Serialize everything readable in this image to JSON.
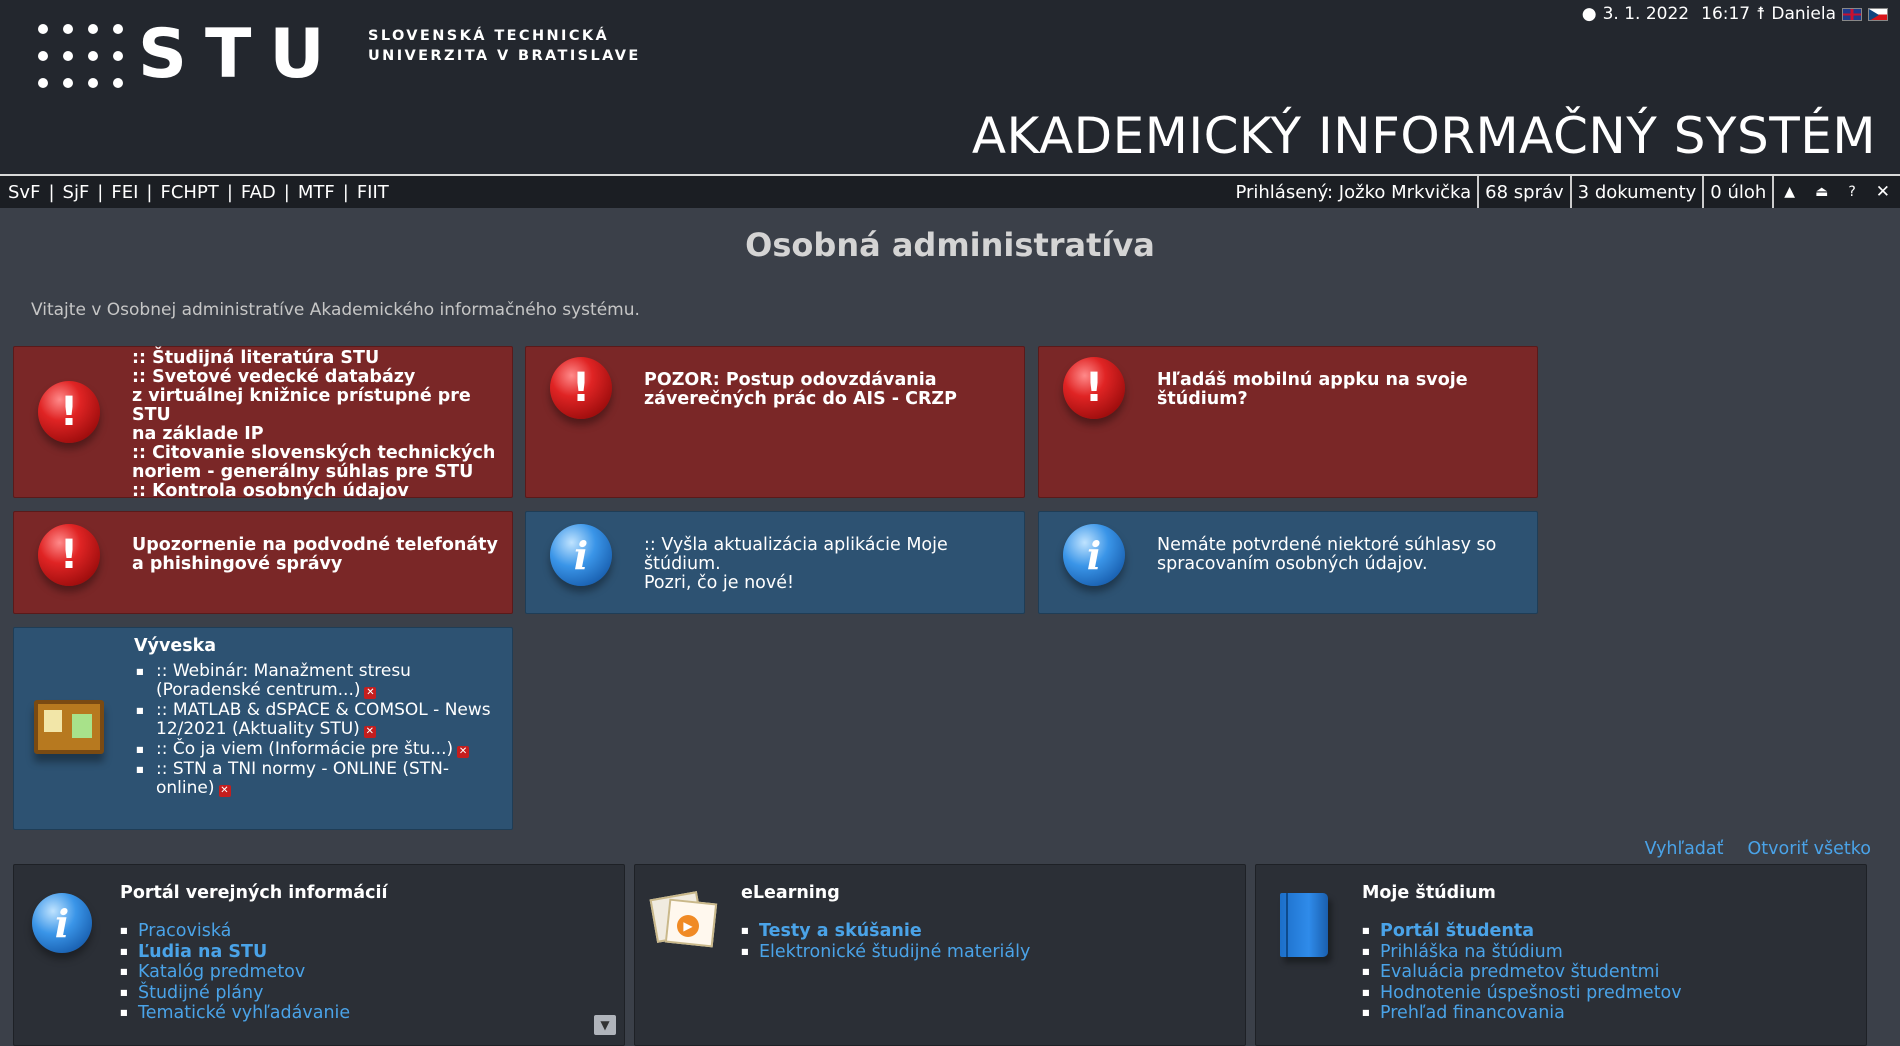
{
  "header": {
    "logo_text": "STU",
    "university_line1": "SLOVENSKÁ TECHNICKÁ",
    "university_line2": "UNIVERZITA V BRATISLAVE",
    "date": "3. 1. 2022",
    "time": "16:17",
    "nameday": "Daniela",
    "system_title": "AKADEMICKÝ INFORMAČNÝ SYSTÉM"
  },
  "nav": {
    "faculties": [
      "SvF",
      "SjF",
      "FEI",
      "FCHPT",
      "FAD",
      "MTF",
      "FIIT"
    ],
    "logged_in": "Prihlásený: Jožko Mrkvička",
    "messages": "68 správ",
    "documents": "3 dokumenty",
    "tasks": "0 úloh",
    "icons": [
      "arrow-up-icon",
      "home-up-icon",
      "help-icon",
      "close-icon"
    ]
  },
  "main": {
    "title": "Osobná administratíva",
    "welcome": "Vitajte v Osobnej administratíve Akademického informačného systému."
  },
  "notices": {
    "box1": {
      "lines": [
        "::  Študijná literatúra STU",
        "::  Svetové vedecké databázy",
        "z virtuálnej knižnice prístupné pre STU",
        "na základe IP",
        "::  Citovanie slovenských technických",
        "noriem - generálny súhlas pre STU",
        "::  Kontrola osobných údajov"
      ]
    },
    "box2": {
      "lines": [
        "POZOR: Postup odovzdávania",
        "záverečných prác do AIS - CRZP"
      ]
    },
    "box3": {
      "lines": [
        "Hľadáš mobilnú appku na svoje",
        "štúdium?"
      ]
    },
    "box4": {
      "lines": [
        "Upozornenie na podvodné telefonáty",
        "a phishingové správy"
      ]
    },
    "box5": {
      "lines": [
        ":: Vyšla aktualizácia aplikácie Moje štúdium.",
        "Pozri, čo je nové!"
      ]
    },
    "box6": {
      "lines": [
        "Nemáte potvrdené niektoré súhlasy so",
        "spracovaním osobných údajov."
      ]
    }
  },
  "vyveska": {
    "title": "Vývesk​a",
    "items": [
      "::  Webinár: Manažment stresu (Poradenské centrum...)",
      "::  MATLAB & dSPACE & COMSOL - News 12/2021 (Aktuality STU)",
      "::  Čo ja viem (Informácie pre štu...)",
      "::  STN a TNI normy - ONLINE (STN-online)"
    ]
  },
  "toplinks": {
    "search": "Vyhľadať",
    "open_all": "Otvoriť všetko"
  },
  "portals": [
    {
      "title": "Portál verejných informácií",
      "links": [
        {
          "label": "Pracoviská",
          "bold": false
        },
        {
          "label": "Ľudia na STU",
          "bold": true
        },
        {
          "label": "Katalóg predmetov",
          "bold": false
        },
        {
          "label": "Študijné plány",
          "bold": false
        },
        {
          "label": "Tematické vyhľadávanie",
          "bold": false
        }
      ]
    },
    {
      "title": "eLearning",
      "links": [
        {
          "label": "Testy a skúšanie",
          "bold": true
        },
        {
          "label": "Elektronické študijné materiály",
          "bold": false
        }
      ]
    },
    {
      "title": "Moje štúdium",
      "links": [
        {
          "label": "Portál študenta",
          "bold": true
        },
        {
          "label": "Prihláška na štúdium",
          "bold": false
        },
        {
          "label": "Evaluácia predmetov študentmi",
          "bold": false
        },
        {
          "label": "Hodnotenie úspešnosti predmetov",
          "bold": false
        },
        {
          "label": "Prehľad financovania",
          "bold": false
        }
      ]
    }
  ],
  "colors": {
    "background": "#3b4049",
    "header": "#23272e",
    "alert_red": "#7a2727",
    "info_blue": "#2d5272",
    "link": "#4aa3e8"
  }
}
